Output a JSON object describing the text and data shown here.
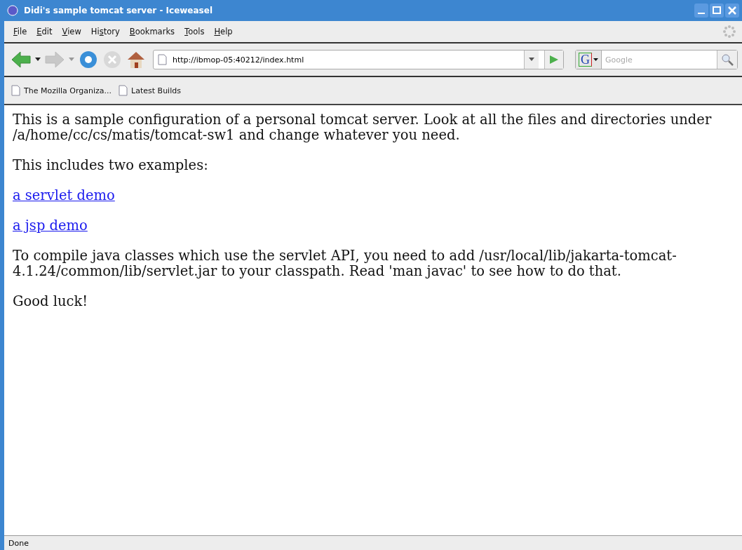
{
  "window": {
    "title": "Didi's sample tomcat server - Iceweasel"
  },
  "menu": [
    {
      "accel": "F",
      "rest": "ile"
    },
    {
      "accel": "E",
      "rest": "dit"
    },
    {
      "accel": "V",
      "rest": "iew"
    },
    {
      "lead": "Hi",
      "accel": "s",
      "rest": "tory"
    },
    {
      "accel": "B",
      "rest": "ookmarks"
    },
    {
      "accel": "T",
      "rest": "ools"
    },
    {
      "accel": "H",
      "rest": "elp"
    }
  ],
  "navigation": {
    "back_disabled": false,
    "forward_disabled": true,
    "stop_disabled": true,
    "url": "http://ibmop-05:40212/index.html",
    "search_engine": "G",
    "search_placeholder": "Google"
  },
  "bookmarks": [
    "The Mozilla Organiza...",
    "Latest Builds"
  ],
  "content": [
    {
      "kind": "text",
      "text": "This is a sample configuration of a personal tomcat server. Look at all the files and directories under /a/home/cc/cs/matis/tomcat-sw1 and change whatever you need."
    },
    {
      "kind": "text",
      "text": "This includes two examples:"
    },
    {
      "kind": "link",
      "text": "a servlet demo"
    },
    {
      "kind": "link",
      "text": "a jsp demo"
    },
    {
      "kind": "text",
      "text": "To compile java classes which use the servlet API, you need to add /usr/local/lib/jakarta-tomcat-4.1.24/common/lib/servlet.jar to your classpath. Read 'man javac' to see how to do that."
    },
    {
      "kind": "text",
      "text": "Good luck!"
    }
  ],
  "status_bar": {
    "text": "Done"
  }
}
